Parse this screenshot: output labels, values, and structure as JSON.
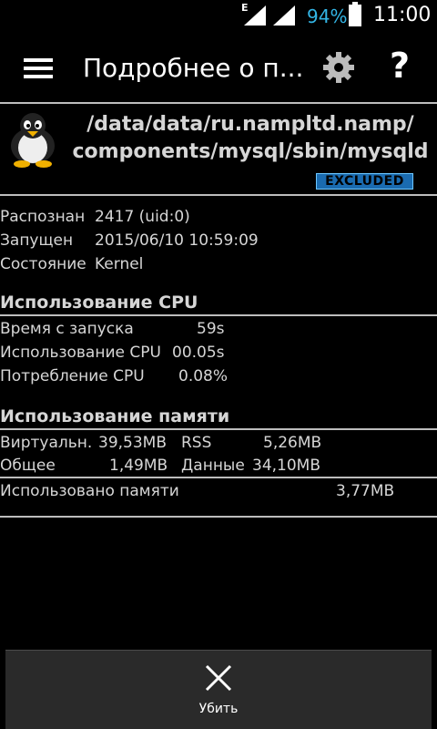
{
  "status_bar": {
    "network": "E",
    "battery_percent": "94%",
    "time": "11:00"
  },
  "action_bar": {
    "title": "Подробнее о п...",
    "icons": [
      "menu-icon",
      "gear-icon",
      "help-icon"
    ],
    "help_label": "?"
  },
  "process": {
    "path_line1": "/data/data/ru.nampltd.namp/",
    "path_line2": "components/mysql/sbin/mysqld",
    "badge": "EXCLUDED"
  },
  "info": {
    "recognized_label": "Распознан",
    "recognized_value": "2417 (uid:0)",
    "started_label": "Запущен",
    "started_value": "2015/06/10 10:59:09",
    "state_label": "Состояние",
    "state_value": "Kernel"
  },
  "cpu": {
    "title": "Использование CPU",
    "uptime_label": "Время с запуска",
    "uptime_value": "59s",
    "usage_label": "Использование CPU",
    "usage_value": "00.05s",
    "consumption_label": "Потребление CPU",
    "consumption_value": "0.08%"
  },
  "memory": {
    "title": "Использование памяти",
    "virtual_label": "Виртуальн.",
    "virtual_value": "39,53MB",
    "rss_label": "RSS",
    "rss_value": "5,26MB",
    "shared_label": "Общее",
    "shared_value": "1,49MB",
    "data_label": "Данные",
    "data_value": "34,10MB",
    "used_label": "Использовано памяти",
    "used_value": "3,77MB"
  },
  "actions": {
    "kill_label": "Убить"
  },
  "colors": {
    "background": "#000000",
    "accent": "#33b5e5",
    "badge": "#1a6bb0",
    "divider": "#bdbdbd"
  }
}
